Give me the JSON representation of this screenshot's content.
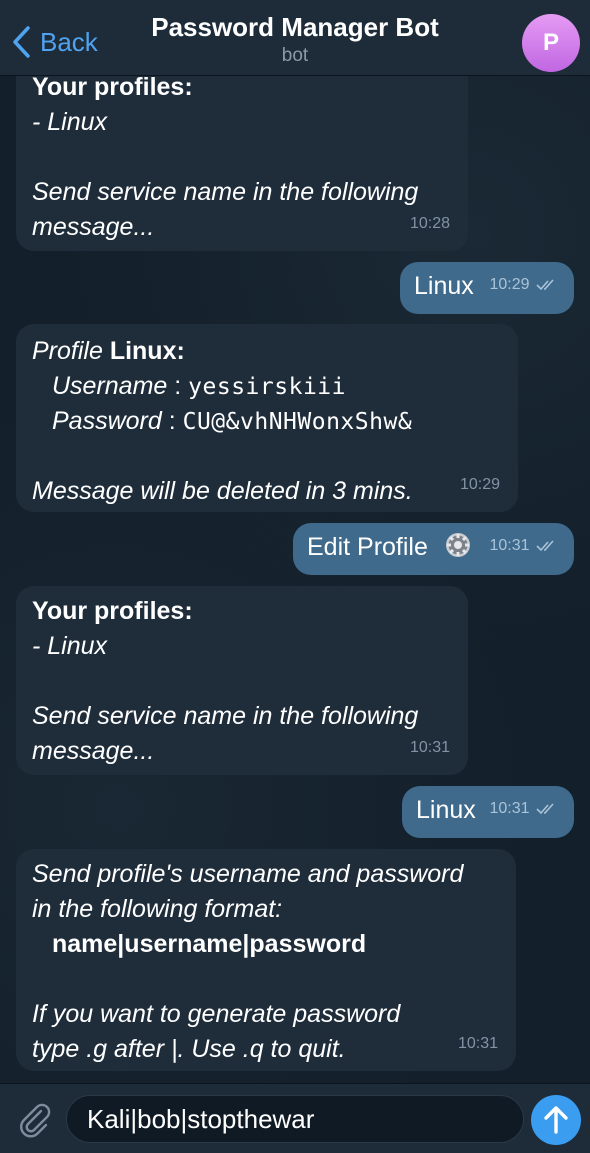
{
  "header": {
    "back_label": "Back",
    "title": "Password Manager Bot",
    "subtitle": "bot",
    "avatar_letter": "P"
  },
  "messages": [
    {
      "from": "bot",
      "heading": "Your profiles:",
      "item": " - Linux",
      "prompt1": "Send service name in the following",
      "prompt2": "message...",
      "time": "10:28"
    },
    {
      "from": "user",
      "text": "Linux",
      "time": "10:29"
    },
    {
      "from": "bot",
      "profile_prefix": "Profile ",
      "profile_name": "Linux:",
      "username_label": "Username",
      "username_value": "yessirskiii",
      "password_label": "Password",
      "password_value": "CU@&vhNHWonxShw&",
      "sep": " : ",
      "note": "Message will be deleted in 3 mins.",
      "time": "10:29"
    },
    {
      "from": "user",
      "text": "Edit Profile",
      "icon": "gear-icon",
      "time": "10:31"
    },
    {
      "from": "bot",
      "heading": "Your profiles:",
      "item": " - Linux",
      "prompt1": "Send service name in the following",
      "prompt2": "message...",
      "time": "10:31"
    },
    {
      "from": "user",
      "text": "Linux",
      "time": "10:31"
    },
    {
      "from": "bot",
      "line1": "Send profile's username and password",
      "line2": "in the following format:",
      "format": "name|username|password",
      "line3": "If you want to generate password",
      "line4": "type .g after |. Use .q to quit.",
      "time": "10:31"
    }
  ],
  "composer": {
    "value": "Kali|bob|stopthewar"
  },
  "colors": {
    "accent": "#4fa3ef",
    "incoming_bubble": "#1f2d3b",
    "outgoing_bubble": "#3f6a8c",
    "send_button": "#3a9df0"
  }
}
